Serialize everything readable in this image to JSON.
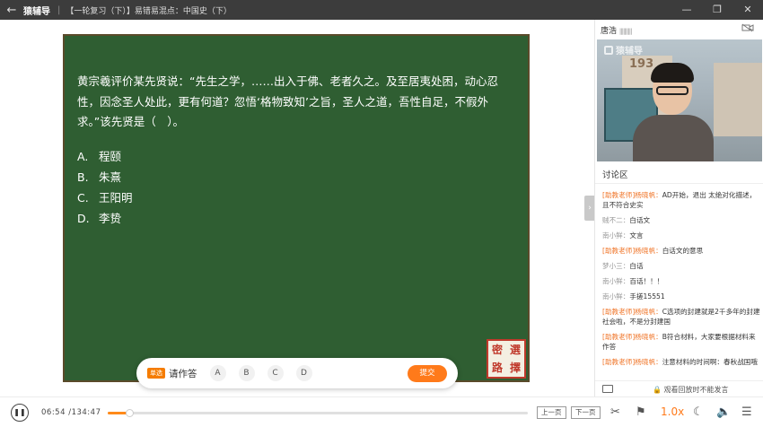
{
  "titlebar": {
    "back_icon": "←",
    "brand": "猿辅导",
    "separator": "|",
    "course": "【一轮复习（下）】易错易混点：中国史（下）",
    "minimize": "—",
    "restore": "❐",
    "close": "✕"
  },
  "board": {
    "question": "黄宗羲评价某先贤说：“先生之学，……出入于佛、老者久之。及至居夷处困，动心忍性，因念圣人处此，更有何道？忽悟‘格物致知’之旨，圣人之道，吾性自足，不假外求。”该先贤是（　）。",
    "options": [
      {
        "key": "A.",
        "text": "程颐"
      },
      {
        "key": "B.",
        "text": "朱熹"
      },
      {
        "key": "C.",
        "text": "王阳明"
      },
      {
        "key": "D.",
        "text": "李贽"
      }
    ],
    "seal": [
      "密",
      "選",
      "路",
      "擇"
    ]
  },
  "answerbar": {
    "tag": "单选",
    "prompt": "请作答",
    "choices": [
      "A",
      "B",
      "C",
      "D"
    ],
    "submit": "提交"
  },
  "side": {
    "teacher_name": "唐浩",
    "signal": "||||||||||",
    "camera_icon": "camera-off-icon",
    "watermark": "猿辅导",
    "backdrop_year": "193",
    "discussion_title": "讨论区",
    "messages": [
      {
        "user": "[助教老师]杨晓帆：",
        "text": "AD开始，退出 太绝对化描述，且不符合史实",
        "teacher": true
      },
      {
        "user": "贼不二：",
        "text": "白话文",
        "teacher": false
      },
      {
        "user": "南小鲜：",
        "text": "文言",
        "teacher": false
      },
      {
        "user": "[助教老师]杨晓帆：",
        "text": "白话文的意思",
        "teacher": true
      },
      {
        "user": "梦小三：",
        "text": "白话",
        "teacher": false
      },
      {
        "user": "南小鲜：",
        "text": "百话！！！",
        "teacher": false
      },
      {
        "user": "南小鲜：",
        "text": "手搓15551",
        "teacher": false
      },
      {
        "user": "[助教老师]杨晓帆：",
        "text": "C选项的封建就是2千多年的封建社会啦，不是分封建国",
        "teacher": true
      },
      {
        "user": "[助教老师]杨晓帆：",
        "text": "B符合材料，大家要根据材料来作答",
        "teacher": true
      },
      {
        "user": "[助教老师]杨晓帆：",
        "text": "注意材料的时间啊：春秋战国哦",
        "teacher": true
      }
    ],
    "footer": "🔒 观看回放时不能发言"
  },
  "controls": {
    "current_time": "06:54",
    "total_time": "/134:47",
    "progress_fraction": 0.051,
    "prev_page": "上一页",
    "next_page": "下一页",
    "speed": "1.0x",
    "accent": "#ff8a1a"
  }
}
